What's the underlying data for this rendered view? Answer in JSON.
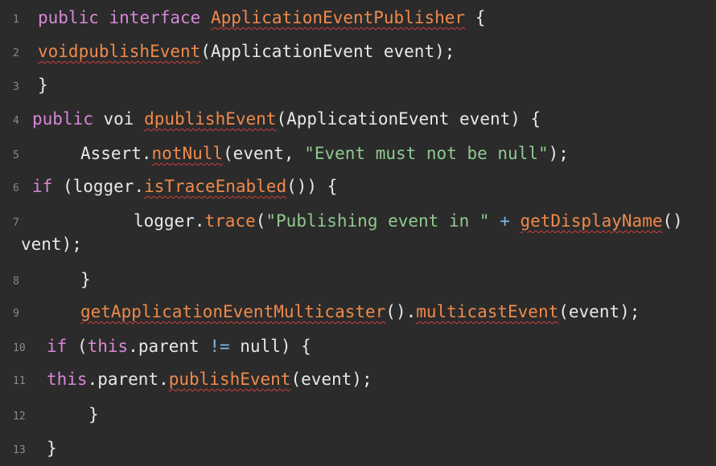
{
  "editor": {
    "lines": [
      {
        "num": "1",
        "tokens": [
          {
            "t": "public",
            "c": "kw"
          },
          {
            "t": " ",
            "c": "plain"
          },
          {
            "t": "interface",
            "c": "kw"
          },
          {
            "t": " ",
            "c": "plain"
          },
          {
            "t": "ApplicationEventPublisher",
            "c": "fn",
            "sq": true
          },
          {
            "t": " {",
            "c": "plain"
          }
        ]
      },
      {
        "num": "2",
        "tokens": [
          {
            "t": "voidpublishEvent",
            "c": "fn",
            "sq": true
          },
          {
            "t": "(ApplicationEvent event);",
            "c": "plain"
          }
        ]
      },
      {
        "num": "3",
        "tokens": [
          {
            "t": "}",
            "c": "plain"
          }
        ]
      },
      {
        "num": "4",
        "tokens": [
          {
            "t": "public",
            "c": "kw"
          },
          {
            "t": " voi ",
            "c": "plain"
          },
          {
            "t": "dpublishEvent",
            "c": "fn",
            "sq": true
          },
          {
            "t": "(ApplicationEvent event) {",
            "c": "plain"
          }
        ]
      },
      {
        "num": "5",
        "tokens": [
          {
            "t": "Assert.",
            "c": "plain"
          },
          {
            "t": "notNull",
            "c": "fn",
            "sq": true
          },
          {
            "t": "(event, ",
            "c": "plain"
          },
          {
            "t": "\"Event must not be null\"",
            "c": "str"
          },
          {
            "t": ");",
            "c": "plain"
          }
        ]
      },
      {
        "num": "6",
        "tokens": [
          {
            "t": "if",
            "c": "kw"
          },
          {
            "t": " (logger.",
            "c": "plain"
          },
          {
            "t": "isTraceEnabled",
            "c": "fn",
            "sq": true
          },
          {
            "t": "()) {",
            "c": "plain"
          }
        ]
      },
      {
        "num": "7",
        "tokens": [
          {
            "t": "logger.",
            "c": "plain"
          },
          {
            "t": "trace",
            "c": "fn"
          },
          {
            "t": "(",
            "c": "plain"
          },
          {
            "t": "\"Publishing event in \"",
            "c": "str"
          },
          {
            "t": " + ",
            "c": "op"
          },
          {
            "t": "getDisplayName",
            "c": "fn",
            "sq": true
          },
          {
            "t": "()",
            "c": "plain"
          }
        ]
      },
      {
        "num": "",
        "tokens": [
          {
            "t": "vent);",
            "c": "plain"
          }
        ]
      },
      {
        "num": "8",
        "tokens": [
          {
            "t": "}",
            "c": "plain"
          }
        ]
      },
      {
        "num": "9",
        "tokens": [
          {
            "t": "getApplicationEventMulticaster",
            "c": "fn",
            "sq": true
          },
          {
            "t": "().",
            "c": "plain"
          },
          {
            "t": "multicastEvent",
            "c": "fn",
            "sq": true
          },
          {
            "t": "(event);",
            "c": "plain"
          }
        ]
      },
      {
        "num": "10",
        "tokens": [
          {
            "t": "if",
            "c": "kw"
          },
          {
            "t": " (",
            "c": "plain"
          },
          {
            "t": "this",
            "c": "kw"
          },
          {
            "t": ".parent ",
            "c": "plain"
          },
          {
            "t": "!=",
            "c": "op"
          },
          {
            "t": " null) {",
            "c": "plain"
          }
        ]
      },
      {
        "num": "11",
        "tokens": [
          {
            "t": "this",
            "c": "kw"
          },
          {
            "t": ".parent.",
            "c": "plain"
          },
          {
            "t": "publishEvent",
            "c": "fn",
            "sq": true
          },
          {
            "t": "(event);",
            "c": "plain"
          }
        ]
      },
      {
        "num": "12",
        "tokens": [
          {
            "t": "}",
            "c": "plain"
          }
        ]
      },
      {
        "num": "13",
        "tokens": [
          {
            "t": "}",
            "c": "plain"
          }
        ]
      }
    ]
  }
}
